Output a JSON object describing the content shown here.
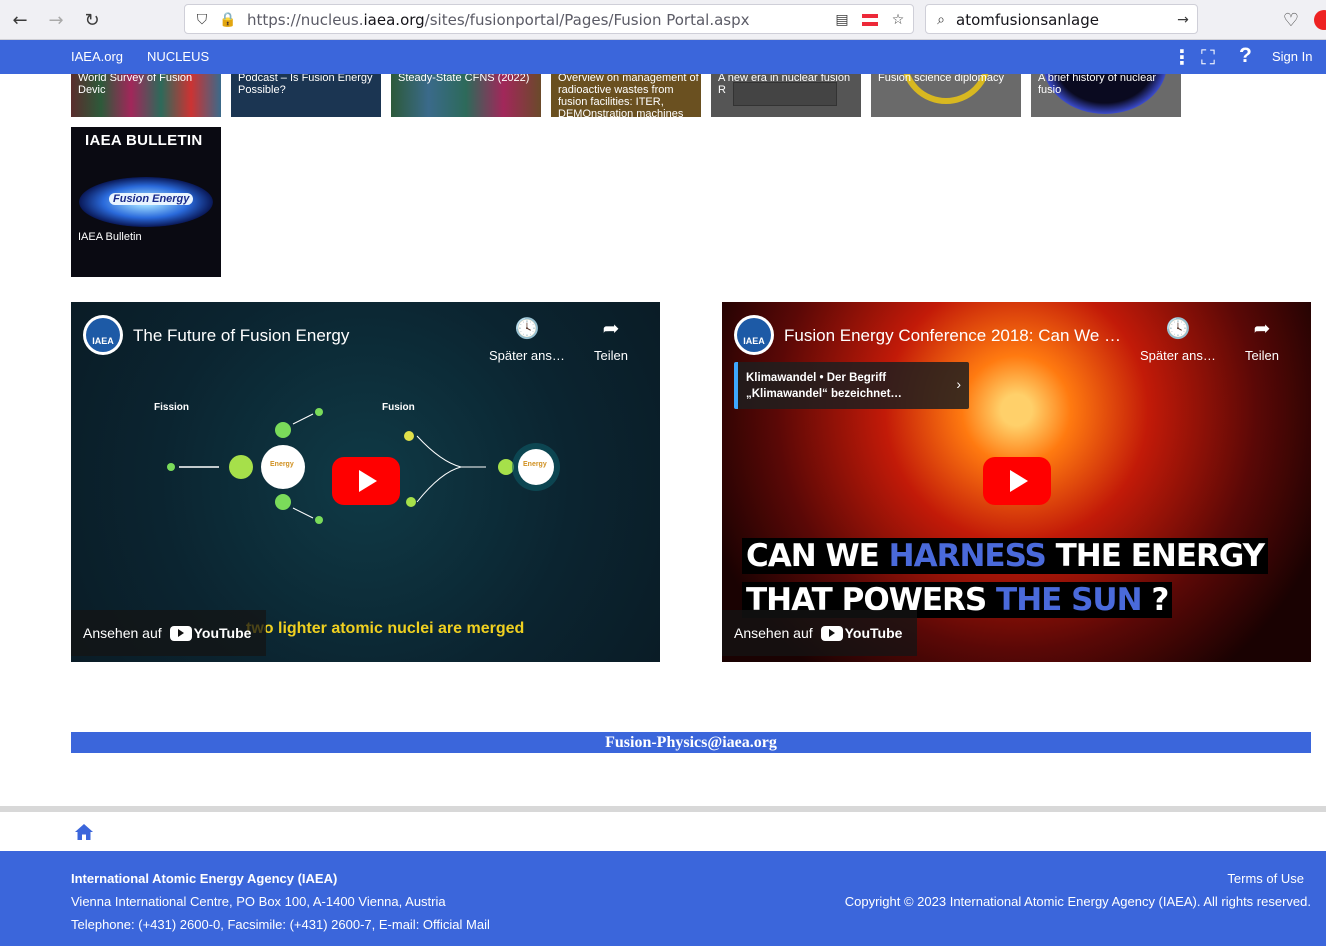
{
  "browser": {
    "url_prefix": "https://nucleus.",
    "url_domain": "iaea.org",
    "url_path": "/sites/fusionportal/Pages/Fusion Portal.aspx",
    "search_value": "atomfusionsanlage"
  },
  "sitenav": {
    "items": [
      "IAEA.org",
      "NUCLEUS"
    ],
    "signin": "Sign In"
  },
  "tiles": [
    {
      "caption": "World Survey of Fusion Devic"
    },
    {
      "caption": "Podcast – Is Fusion Energy Possible?"
    },
    {
      "caption": "Steady-State CFNS (2022)"
    },
    {
      "caption": "Overview on management of radioactive wastes from fusion facilities: ITER, DEMOnstration machines and power plants"
    },
    {
      "caption": "A new era in nuclear fusion R"
    },
    {
      "caption": "Fusion science diplomacy"
    },
    {
      "caption": "A brief history of nuclear fusio"
    },
    {
      "caption": "IAEA Bulletin",
      "header": "IAEA BULLETIN",
      "art": "Fusion Energy"
    }
  ],
  "videos": [
    {
      "title": "The Future of Fusion Energy",
      "watch_later": "Später ans…",
      "share": "Teilen",
      "watch_on": "Ansehen auf",
      "diagram_left": "Fission",
      "diagram_right": "Fusion",
      "energy": "Energy",
      "subtitle": "two lighter atomic nuclei are merged"
    },
    {
      "title": "Fusion Energy Conference 2018: Can We …",
      "watch_later": "Später ans…",
      "share": "Teilen",
      "watch_on": "Ansehen auf",
      "info_card": "Klimawandel • Der Begriff „Klimawandel“ bezeichnet…",
      "headline1a": "CAN WE ",
      "headline1b": "HARNESS",
      "headline1c": " THE ENERGY",
      "headline2a": "THAT POWERS ",
      "headline2b": "THE SUN",
      "headline2c": " ?"
    }
  ],
  "logo_text": "IAEA",
  "youtube": "YouTube",
  "mail": "Fusion-Physics@iaea.org",
  "footer": {
    "org": "International Atomic Energy Agency (IAEA)",
    "address": "Vienna International Centre, PO Box 100, A-1400 Vienna, Austria",
    "tel_label": "Telephone: ",
    "tel": "(+431) 2600-0",
    "fax": ", Facsimile: (+431) 2600-7, E-mail: ",
    "mail_link": "Official Mail",
    "terms": "Terms of Use",
    "copyright": "Copyright © 2023 International Atomic Energy Agency (IAEA). All rights reserved."
  },
  "colors": {
    "brand": "#3b66db",
    "play": "#ff0000"
  }
}
